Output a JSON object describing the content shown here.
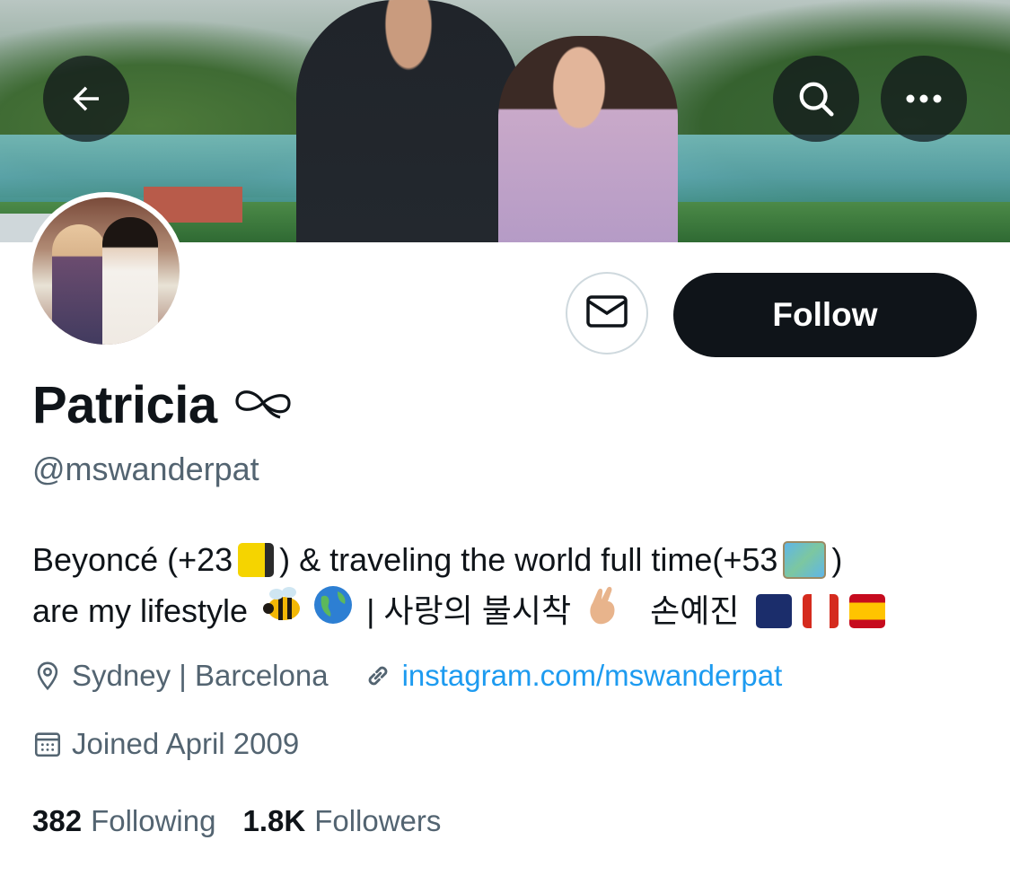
{
  "profile": {
    "name": "Patricia",
    "handle": "@mswanderpat",
    "bio_line1_a": "Beyoncé (+23",
    "bio_line1_b": ") & traveling the world full time(+53",
    "bio_line1_c": ")",
    "bio_line2_a": "are my lifestyle",
    "bio_line2_b": "| 사랑의 불시착",
    "bio_line2_c": "손예진",
    "location": "Sydney | Barcelona",
    "website": "instagram.com/mswanderpat",
    "joined": "Joined April 2009",
    "following_count": "382",
    "following_label": "Following",
    "followers_count": "1.8K",
    "followers_label": "Followers"
  },
  "actions": {
    "follow_label": "Follow"
  },
  "icons": {
    "back": "arrow-left-icon",
    "search": "search-icon",
    "more": "more-icon",
    "message": "envelope-icon",
    "location": "location-pin-icon",
    "link": "link-icon",
    "calendar": "calendar-icon"
  },
  "colors": {
    "follow_bg": "#0f1419",
    "link": "#1d9bf0",
    "secondary_text": "#536471"
  }
}
